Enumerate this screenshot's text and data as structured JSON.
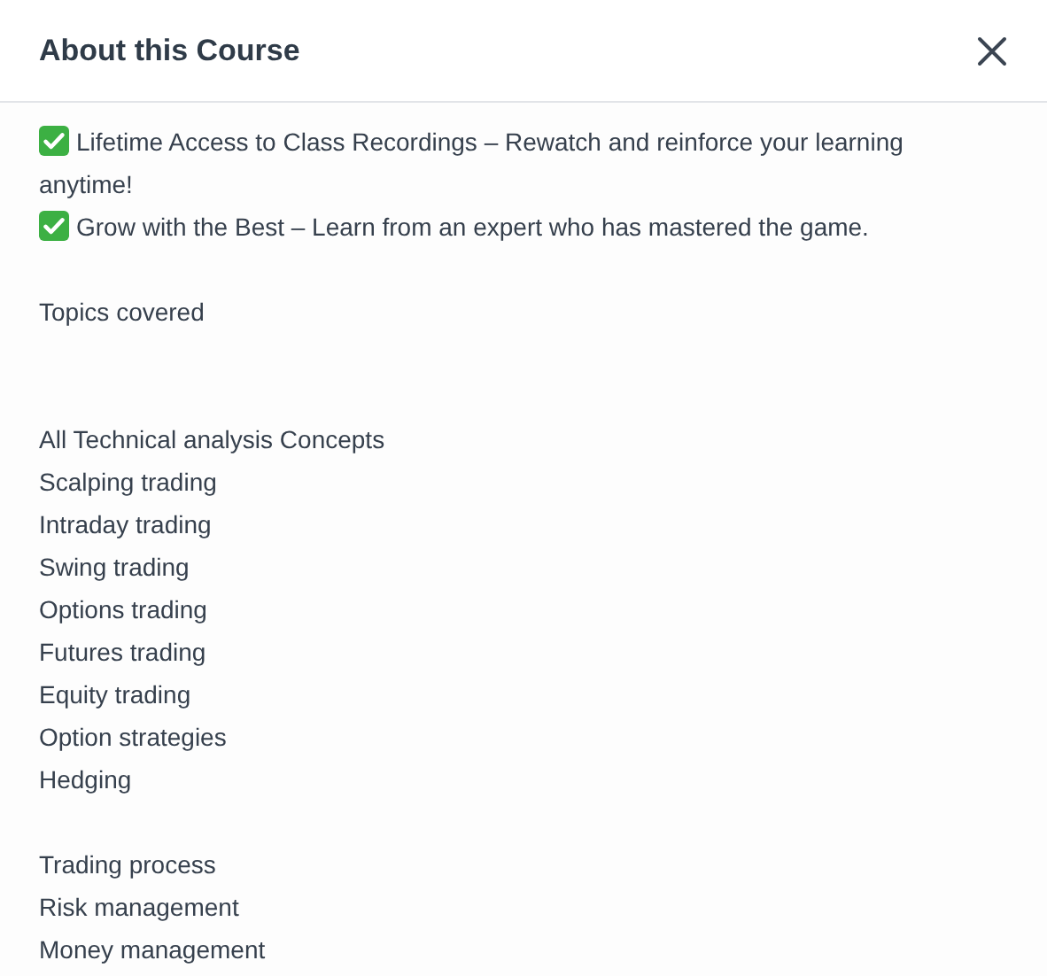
{
  "dialog": {
    "title": "About this Course"
  },
  "lines": [
    {
      "kind": "check",
      "text": "Lifetime Access to Class Recordings – Rewatch and reinforce your learning anytime!"
    },
    {
      "kind": "check",
      "text": "Grow with the Best – Learn from an expert who has mastered the game."
    },
    {
      "kind": "blank"
    },
    {
      "kind": "plain",
      "text": "Topics covered"
    },
    {
      "kind": "blank"
    },
    {
      "kind": "blank"
    },
    {
      "kind": "plain",
      "text": "All Technical analysis Concepts"
    },
    {
      "kind": "plain",
      "text": "Scalping trading"
    },
    {
      "kind": "plain",
      "text": "Intraday trading"
    },
    {
      "kind": "plain",
      "text": "Swing trading"
    },
    {
      "kind": "plain",
      "text": "Options trading"
    },
    {
      "kind": "plain",
      "text": "Futures trading"
    },
    {
      "kind": "plain",
      "text": "Equity trading"
    },
    {
      "kind": "plain",
      "text": "Option strategies"
    },
    {
      "kind": "plain",
      "text": "Hedging"
    },
    {
      "kind": "blank"
    },
    {
      "kind": "plain",
      "text": "Trading process"
    },
    {
      "kind": "plain",
      "text": "Risk management"
    },
    {
      "kind": "plain",
      "text": "Money management"
    }
  ]
}
